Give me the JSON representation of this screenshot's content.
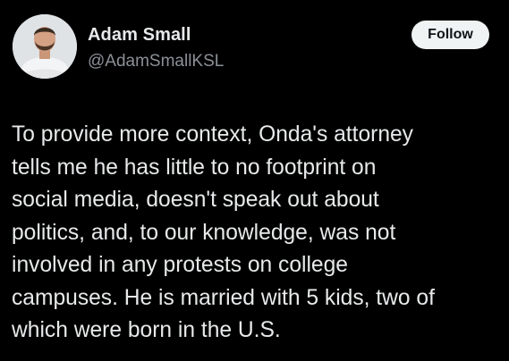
{
  "author": {
    "display_name": "Adam Small",
    "handle": "@AdamSmallKSL",
    "avatar_icon": "profile-photo"
  },
  "follow_button": {
    "label": "Follow"
  },
  "tweet": {
    "text": "To provide more context, Onda's attorney\ntells me he has little to no footprint on\nsocial media, doesn't speak out about\npolitics, and, to our knowledge, was not\ninvolved in any protests on college\ncampuses. He is married with 5 kids, two of\nwhich were born in the U.S."
  },
  "colors": {
    "background": "#000000",
    "text_primary": "#e7e9ea",
    "text_secondary": "#8b9096",
    "follow_bg": "#eff3f4",
    "follow_text": "#0f1419"
  }
}
